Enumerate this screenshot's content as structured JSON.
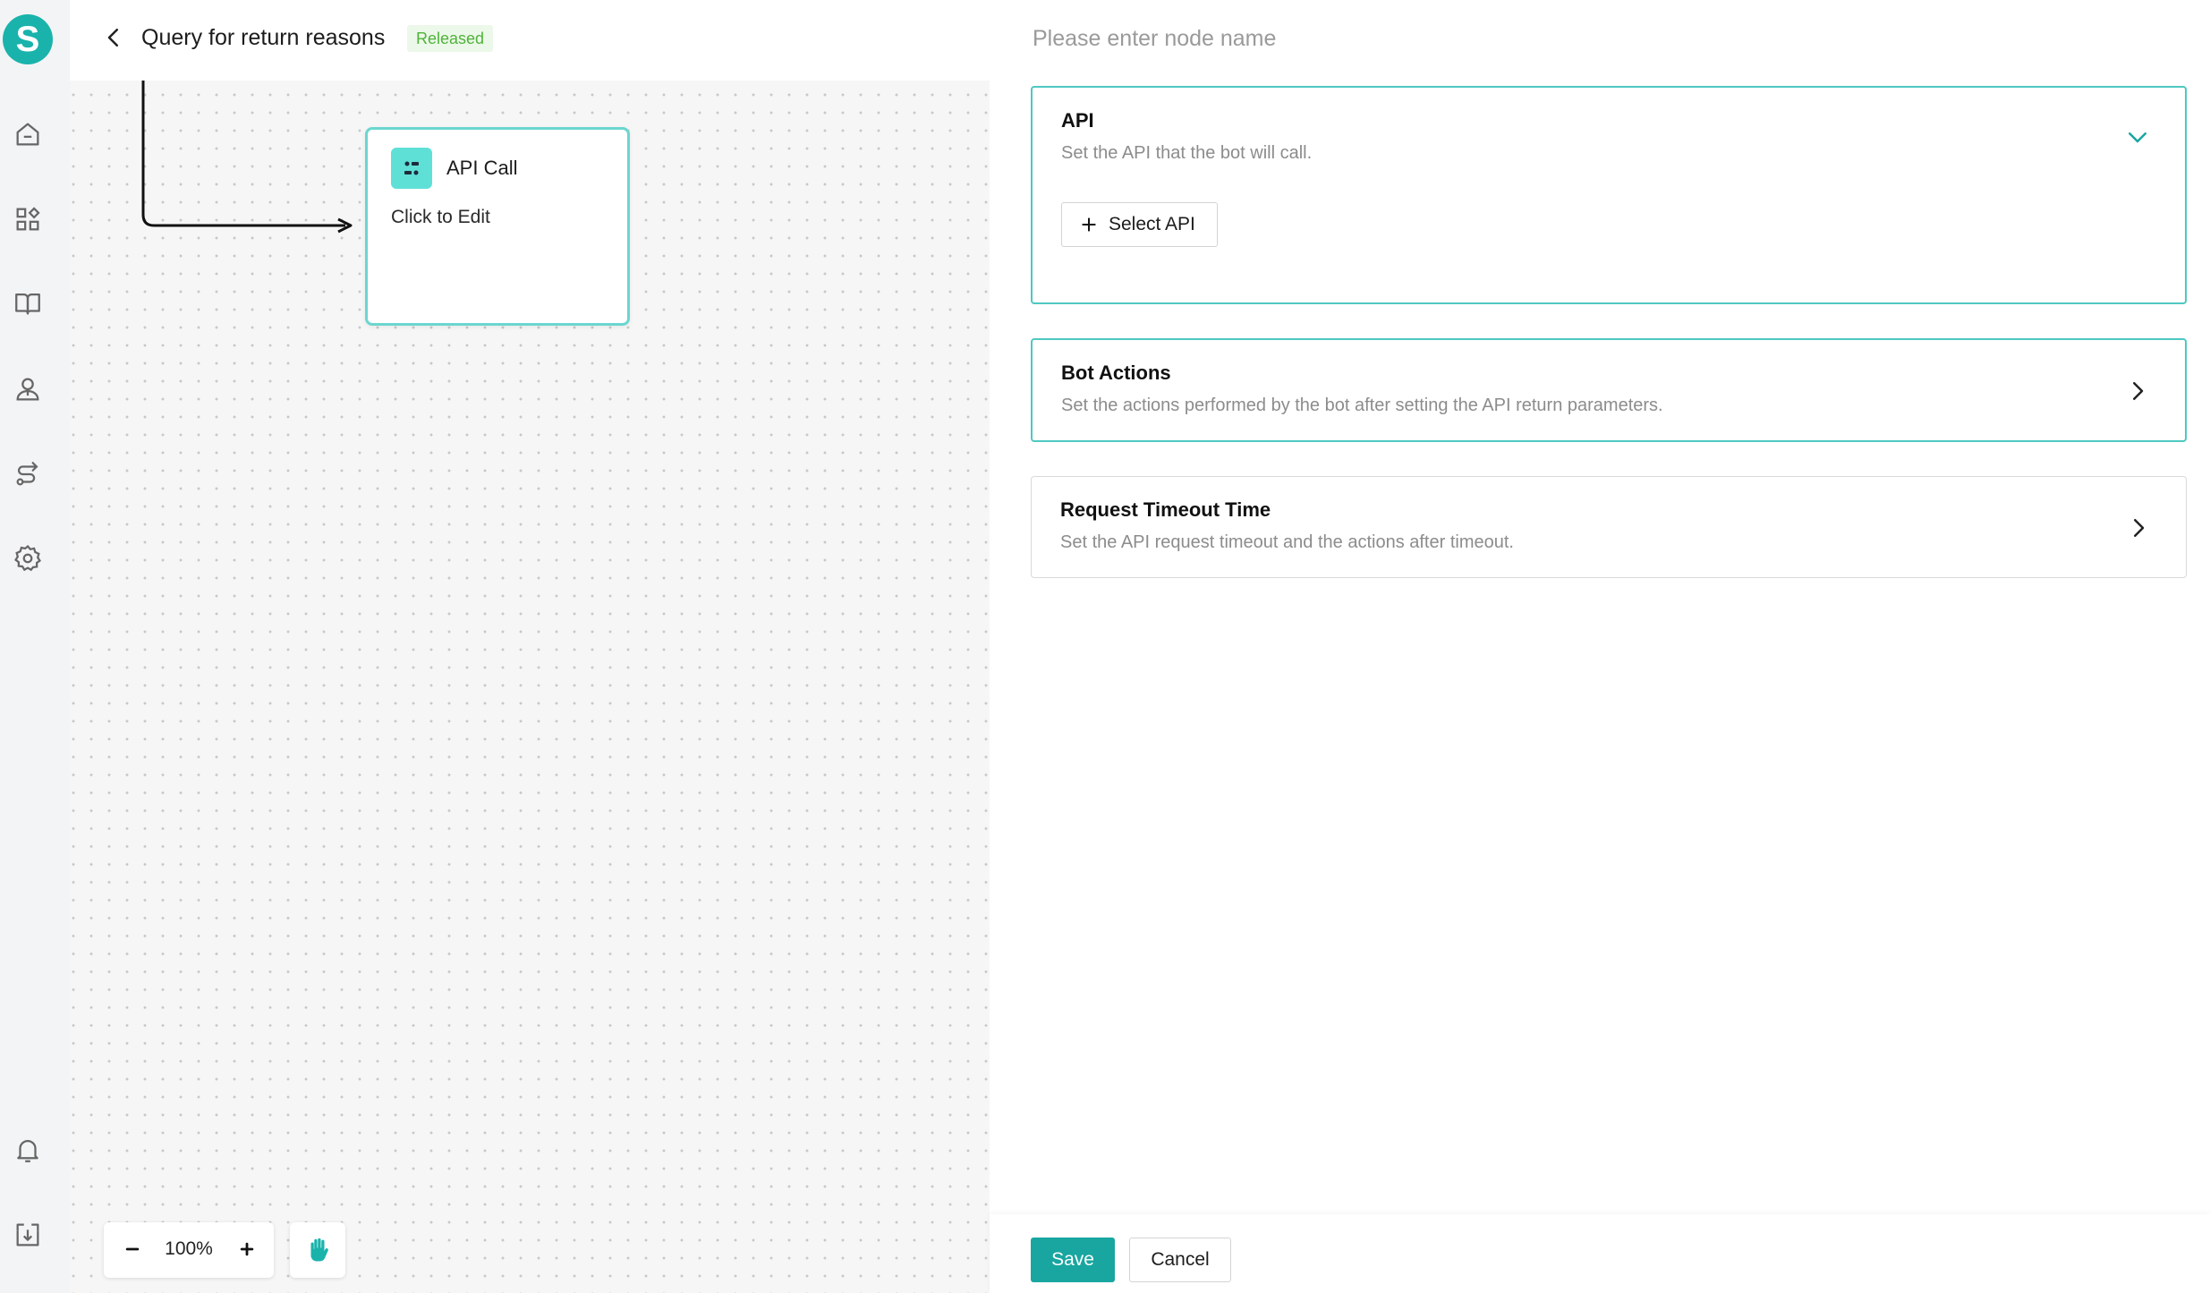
{
  "app": {
    "logo_letter": "S"
  },
  "nav_icons": [
    "home-icon",
    "apps-icon",
    "book-icon",
    "user-icon",
    "route-icon",
    "gear-icon",
    "bell-icon",
    "download-icon"
  ],
  "header": {
    "title": "Query for return reasons",
    "status": "Released"
  },
  "canvas": {
    "node": {
      "title": "API Call",
      "subtitle": "Click to Edit"
    },
    "zoom": {
      "level": "100%"
    }
  },
  "panel": {
    "node_name_placeholder": "Please enter node name",
    "sections": [
      {
        "title": "API",
        "description": "Set the API that the bot will call.",
        "expanded": true,
        "button": "Select API"
      },
      {
        "title": "Bot Actions",
        "description": "Set the actions performed by the bot after setting the API return parameters.",
        "expanded": false
      },
      {
        "title": "Request Timeout Time",
        "description": "Set the API request timeout and the actions after timeout.",
        "expanded": false
      }
    ],
    "footer": {
      "save": "Save",
      "cancel": "Cancel"
    }
  },
  "colors": {
    "accent": "#19a6a0",
    "released_badge": "#4fb33a",
    "node_border": "#6cd6cf"
  }
}
